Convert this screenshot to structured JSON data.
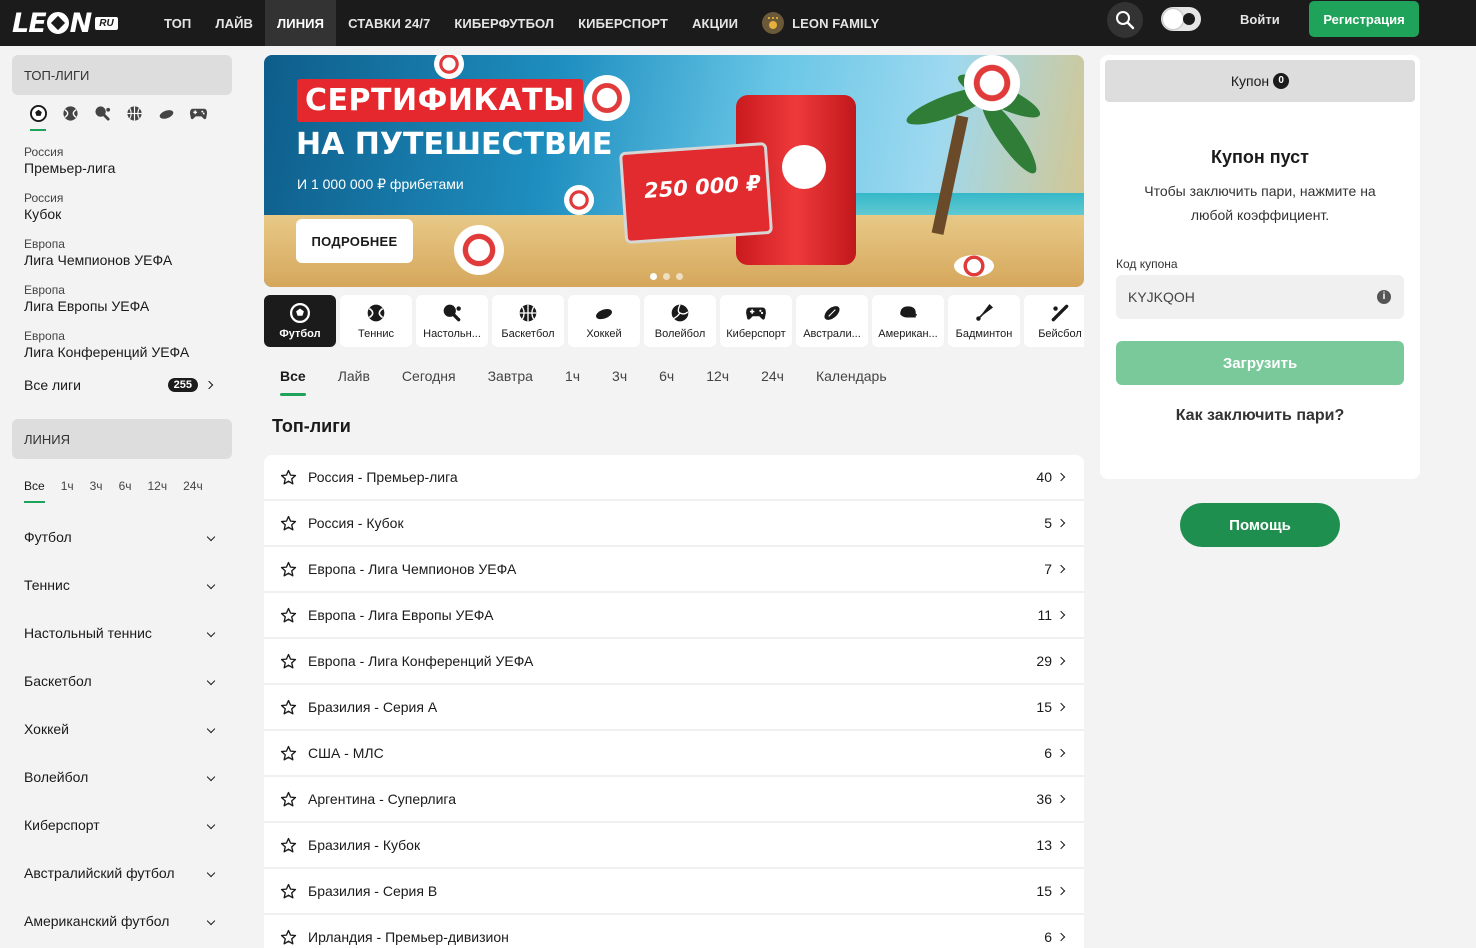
{
  "header": {
    "logo": "LEON",
    "logo_badge": "RU",
    "nav": [
      {
        "label": "ТОП"
      },
      {
        "label": "ЛАЙВ"
      },
      {
        "label": "ЛИНИЯ",
        "active": true
      },
      {
        "label": "СТАВКИ 24/7"
      },
      {
        "label": "КИБЕРФУТБОЛ"
      },
      {
        "label": "КИБЕРСПОРТ"
      },
      {
        "label": "АКЦИИ"
      },
      {
        "label": "LEON FAMILY"
      }
    ],
    "login_label": "Войти",
    "register_label": "Регистрация",
    "accent_color": "#1fa25a"
  },
  "sidebar": {
    "top_leagues_title": "ТОП-ЛИГИ",
    "sport_icons": [
      "soccer-ball-icon",
      "tennis-ball-icon",
      "table-tennis-icon",
      "basketball-icon",
      "hockey-puck-icon",
      "gamepad-icon"
    ],
    "top_leagues": [
      {
        "category": "Россия",
        "name": "Премьер-лига"
      },
      {
        "category": "Россия",
        "name": "Кубок"
      },
      {
        "category": "Европа",
        "name": "Лига Чемпионов УЕФА"
      },
      {
        "category": "Европа",
        "name": "Лига Европы УЕФА"
      },
      {
        "category": "Европа",
        "name": "Лига Конференций УЕФА"
      }
    ],
    "all_leagues_label": "Все лиги",
    "all_leagues_count": "255",
    "line_title": "ЛИНИЯ",
    "time_filters": [
      "Все",
      "1ч",
      "3ч",
      "6ч",
      "12ч",
      "24ч"
    ],
    "sports": [
      "Футбол",
      "Теннис",
      "Настольный теннис",
      "Баскетбол",
      "Хоккей",
      "Волейбол",
      "Киберспорт",
      "Австралийский футбол",
      "Американский футбол"
    ]
  },
  "banner": {
    "badge": "СЕРТИФИКАТЫ",
    "title": "НА ПУТЕШЕСТВИЕ",
    "subtitle": "И 1 000 000 ₽ фрибетами",
    "button_label": "ПОДРОБНЕЕ",
    "certificate_amount": "250 000 ₽",
    "certificate_top": "СЕРТИФИКАТ",
    "certificate_bottom": "НА ПУТЕШЕСТВИЕ"
  },
  "sport_tabs": [
    {
      "label": "Футбол",
      "icon": "soccer-ball-icon"
    },
    {
      "label": "Теннис",
      "icon": "tennis-ball-icon"
    },
    {
      "label": "Настольн...",
      "icon": "table-tennis-icon"
    },
    {
      "label": "Баскетбол",
      "icon": "basketball-icon"
    },
    {
      "label": "Хоккей",
      "icon": "hockey-puck-icon"
    },
    {
      "label": "Волейбол",
      "icon": "volleyball-icon"
    },
    {
      "label": "Киберспорт",
      "icon": "gamepad-icon"
    },
    {
      "label": "Австрали...",
      "icon": "rugby-ball-icon"
    },
    {
      "label": "Америкaн...",
      "icon": "football-helmet-icon"
    },
    {
      "label": "Бадминтон",
      "icon": "shuttlecock-icon"
    },
    {
      "label": "Бейсбол",
      "icon": "baseball-bat-icon"
    }
  ],
  "filter_tabs": [
    "Все",
    "Лайв",
    "Сегодня",
    "Завтра",
    "1ч",
    "3ч",
    "6ч",
    "12ч",
    "24ч",
    "Календарь"
  ],
  "section_title": "Топ-лиги",
  "leagues": [
    {
      "name": "Россия - Премьер-лига",
      "count": "40"
    },
    {
      "name": "Россия - Кубок",
      "count": "5"
    },
    {
      "name": "Европа - Лига Чемпионов УЕФА",
      "count": "7"
    },
    {
      "name": "Европа - Лига Европы УЕФА",
      "count": "11"
    },
    {
      "name": "Европа - Лига Конференций УЕФА",
      "count": "29"
    },
    {
      "name": "Бразилия - Серия А",
      "count": "15"
    },
    {
      "name": "США - МЛС",
      "count": "6"
    },
    {
      "name": "Аргентина - Суперлига",
      "count": "36"
    },
    {
      "name": "Бразилия - Кубок",
      "count": "13"
    },
    {
      "name": "Бразилия - Серия В",
      "count": "15"
    },
    {
      "name": "Ирландия - Премьер-дивизион",
      "count": "6"
    }
  ],
  "coupon": {
    "title": "Купон",
    "count": "0",
    "empty_title": "Купон пуст",
    "empty_hint": "Чтобы заключить пари, нажмите на любой коэффициент.",
    "code_label": "Код купона",
    "code_value": "KYJKQOH",
    "load_label": "Загрузить",
    "how_label": "Как заключить пари?"
  },
  "help_label": "Помощь"
}
